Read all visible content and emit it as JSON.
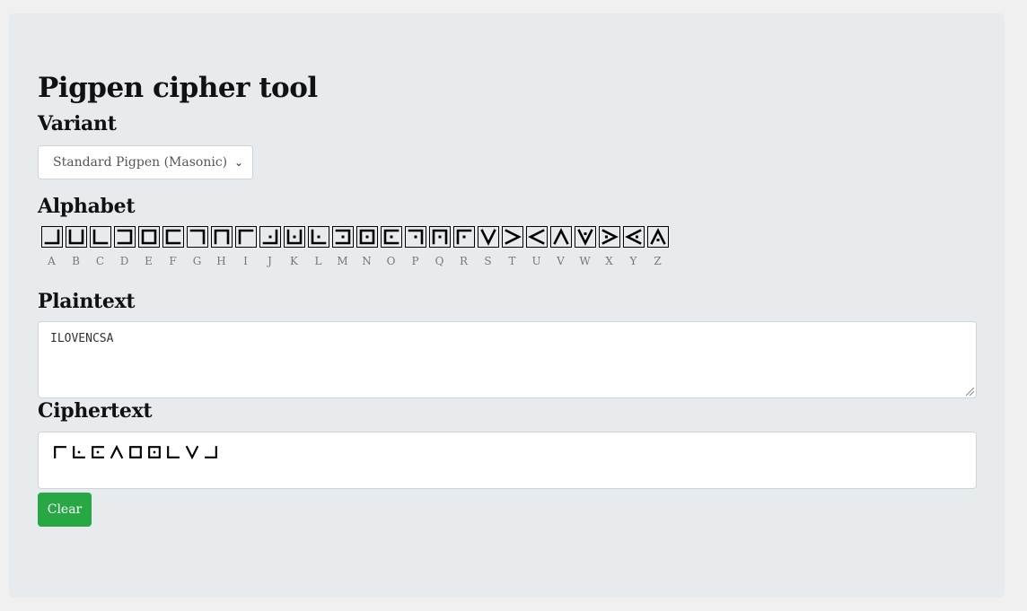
{
  "page": {
    "title": "Pigpen cipher tool"
  },
  "variant": {
    "label": "Variant",
    "selected": "Standard Pigpen (Masonic)"
  },
  "alphabet": {
    "label": "Alphabet",
    "letters": [
      "A",
      "B",
      "C",
      "D",
      "E",
      "F",
      "G",
      "H",
      "I",
      "J",
      "K",
      "L",
      "M",
      "N",
      "O",
      "P",
      "Q",
      "R",
      "S",
      "T",
      "U",
      "V",
      "W",
      "X",
      "Y",
      "Z"
    ]
  },
  "plaintext": {
    "label": "Plaintext",
    "value": "ILOVENCSA"
  },
  "ciphertext": {
    "label": "Ciphertext",
    "value": "ILOVENCSA"
  },
  "clear_button": {
    "label": "Clear"
  },
  "colors": {
    "button": "#28a745",
    "card": "#e8ebee",
    "glyph": "#000000"
  }
}
